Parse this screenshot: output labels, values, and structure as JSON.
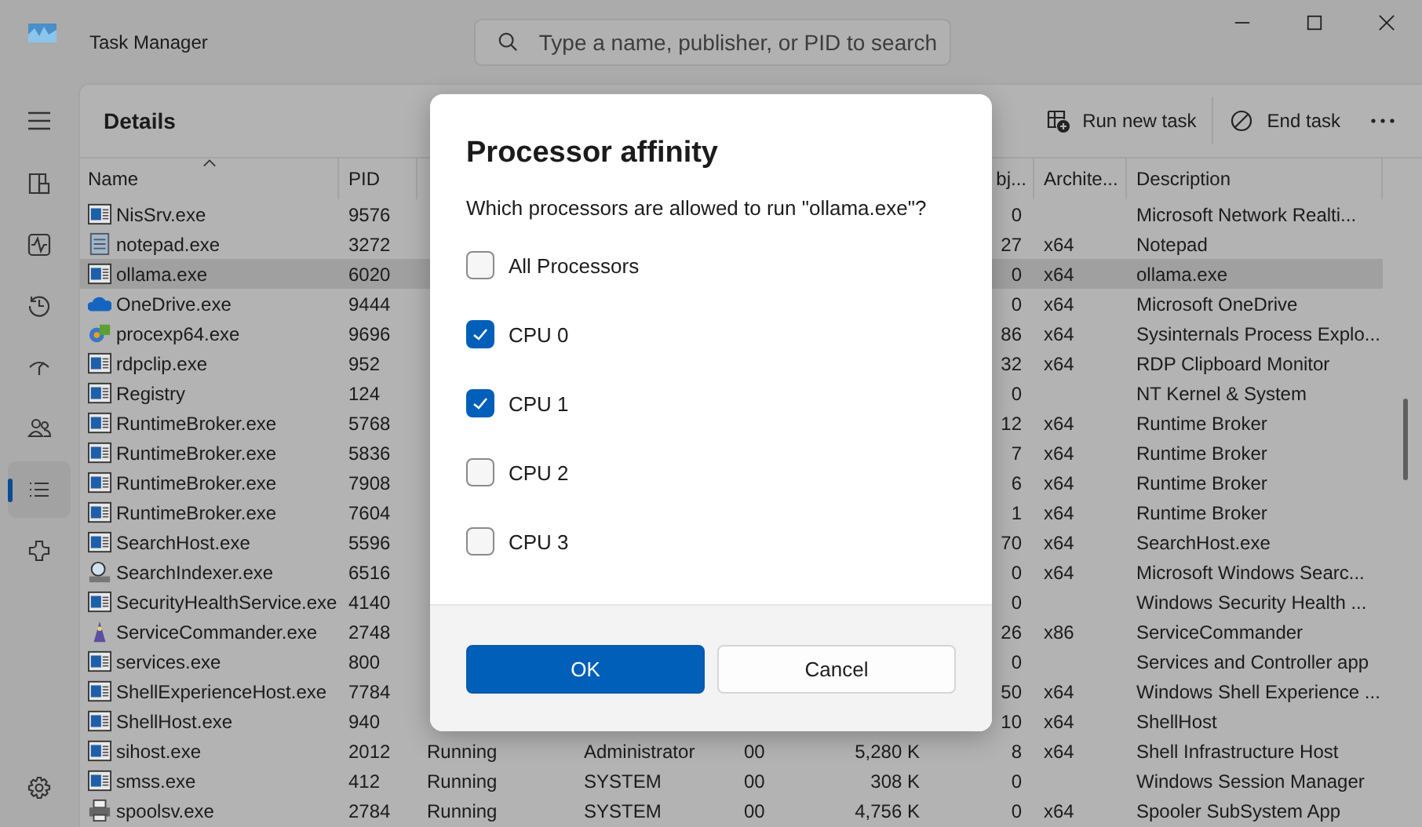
{
  "window": {
    "title": "Task Manager"
  },
  "search": {
    "placeholder": "Type a name, publisher, or PID to search"
  },
  "nav": [
    {
      "kind": "processes",
      "selected": false
    },
    {
      "kind": "performance",
      "selected": false
    },
    {
      "kind": "history",
      "selected": false
    },
    {
      "kind": "startup",
      "selected": false
    },
    {
      "kind": "users",
      "selected": false
    },
    {
      "kind": "details",
      "selected": true
    },
    {
      "kind": "services",
      "selected": false
    }
  ],
  "page_title": "Details",
  "toolbar": [
    {
      "kind": "run",
      "label": "Run new task"
    },
    {
      "kind": "end",
      "label": "End task"
    }
  ],
  "table": {
    "columns": [
      "Name",
      "PID",
      "bj...",
      "Archite...",
      "Description"
    ],
    "rows": [
      {
        "kind": "window",
        "name": "NisSrv.exe",
        "pid": "9576",
        "objects": "0",
        "arch": "",
        "description": "Microsoft Network Realti...",
        "selected": false
      },
      {
        "kind": "notepad",
        "name": "notepad.exe",
        "pid": "3272",
        "objects": "27",
        "arch": "x64",
        "description": "Notepad",
        "selected": false
      },
      {
        "kind": "window",
        "name": "ollama.exe",
        "pid": "6020",
        "objects": "0",
        "arch": "x64",
        "description": "ollama.exe",
        "selected": true
      },
      {
        "kind": "cloud",
        "name": "OneDrive.exe",
        "pid": "9444",
        "objects": "0",
        "arch": "x64",
        "description": "Microsoft OneDrive",
        "selected": false
      },
      {
        "kind": "procexp",
        "name": "procexp64.exe",
        "pid": "9696",
        "objects": "86",
        "arch": "x64",
        "description": "Sysinternals Process Explo...",
        "selected": false
      },
      {
        "kind": "window",
        "name": "rdpclip.exe",
        "pid": "952",
        "objects": "32",
        "arch": "x64",
        "description": "RDP Clipboard Monitor",
        "selected": false
      },
      {
        "kind": "window",
        "name": "Registry",
        "pid": "124",
        "objects": "0",
        "arch": "",
        "description": "NT Kernel & System",
        "selected": false
      },
      {
        "kind": "window",
        "name": "RuntimeBroker.exe",
        "pid": "5768",
        "objects": "12",
        "arch": "x64",
        "description": "Runtime Broker",
        "selected": false
      },
      {
        "kind": "window",
        "name": "RuntimeBroker.exe",
        "pid": "5836",
        "objects": "7",
        "arch": "x64",
        "description": "Runtime Broker",
        "selected": false
      },
      {
        "kind": "window",
        "name": "RuntimeBroker.exe",
        "pid": "7908",
        "objects": "6",
        "arch": "x64",
        "description": "Runtime Broker",
        "selected": false
      },
      {
        "kind": "window",
        "name": "RuntimeBroker.exe",
        "pid": "7604",
        "objects": "1",
        "arch": "x64",
        "description": "Runtime Broker",
        "selected": false
      },
      {
        "kind": "window",
        "name": "SearchHost.exe",
        "pid": "5596",
        "objects": "70",
        "arch": "x64",
        "description": "SearchHost.exe",
        "selected": false
      },
      {
        "kind": "search",
        "name": "SearchIndexer.exe",
        "pid": "6516",
        "objects": "0",
        "arch": "x64",
        "description": "Microsoft Windows Searc...",
        "selected": false
      },
      {
        "kind": "window",
        "name": "SecurityHealthService.exe",
        "pid": "4140",
        "objects": "0",
        "arch": "",
        "description": "Windows Security Health ...",
        "selected": false
      },
      {
        "kind": "wizard",
        "name": "ServiceCommander.exe",
        "pid": "2748",
        "objects": "26",
        "arch": "x86",
        "description": "ServiceCommander",
        "selected": false
      },
      {
        "kind": "window",
        "name": "services.exe",
        "pid": "800",
        "objects": "0",
        "arch": "",
        "description": "Services and Controller app",
        "selected": false
      },
      {
        "kind": "window",
        "name": "ShellExperienceHost.exe",
        "pid": "7784",
        "objects": "50",
        "arch": "x64",
        "description": "Windows Shell Experience ...",
        "selected": false
      },
      {
        "kind": "window",
        "name": "ShellHost.exe",
        "pid": "940",
        "objects": "10",
        "arch": "x64",
        "description": "ShellHost",
        "selected": false
      },
      {
        "kind": "window",
        "name": "sihost.exe",
        "pid": "2012",
        "status": "Running",
        "user": "Administrator",
        "cpu": "00",
        "memory": "5,280 K",
        "objects": "8",
        "arch": "x64",
        "description": "Shell Infrastructure Host",
        "selected": false
      },
      {
        "kind": "window",
        "name": "smss.exe",
        "pid": "412",
        "status": "Running",
        "user": "SYSTEM",
        "cpu": "00",
        "memory": "308 K",
        "objects": "0",
        "arch": "",
        "description": "Windows Session Manager",
        "selected": false
      },
      {
        "kind": "printer",
        "name": "spoolsv.exe",
        "pid": "2784",
        "status": "Running",
        "user": "SYSTEM",
        "cpu": "00",
        "memory": "4,756 K",
        "objects": "0",
        "arch": "x64",
        "description": "Spooler SubSystem App",
        "selected": false
      }
    ]
  },
  "dialog": {
    "title": "Processor affinity",
    "prompt": "Which processors are allowed to run \"ollama.exe\"?",
    "options": [
      {
        "label": "All Processors",
        "checked": false
      },
      {
        "label": "CPU 0",
        "checked": true
      },
      {
        "label": "CPU 1",
        "checked": true
      },
      {
        "label": "CPU 2",
        "checked": false
      },
      {
        "label": "CPU 3",
        "checked": false
      }
    ],
    "buttons": [
      {
        "label": "OK",
        "kind": "primary"
      },
      {
        "label": "Cancel",
        "kind": "secondary"
      }
    ]
  }
}
